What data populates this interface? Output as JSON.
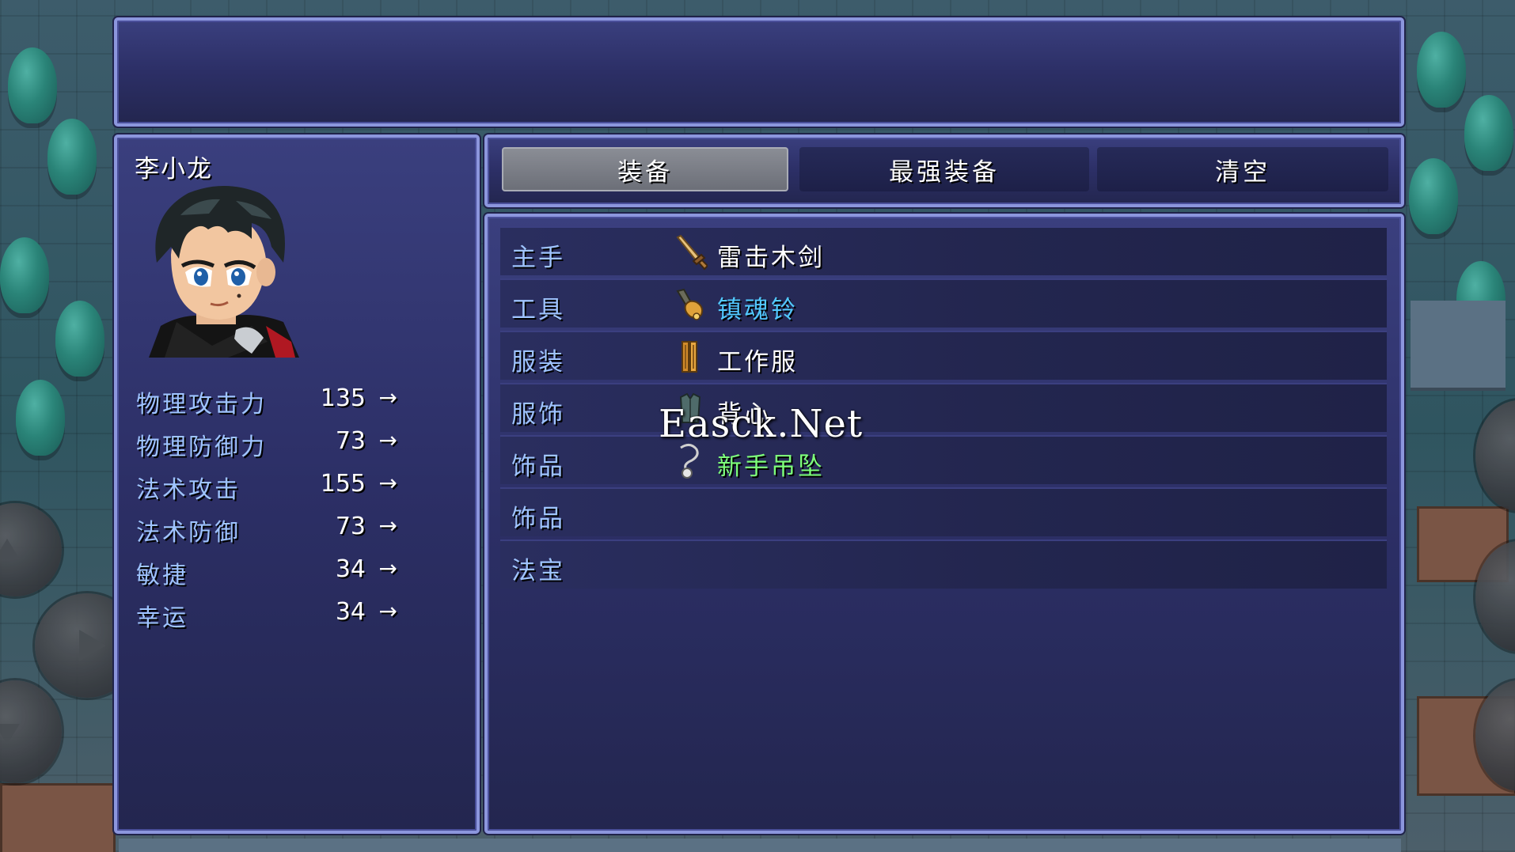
{
  "actor": {
    "name": "李小龙"
  },
  "params": [
    {
      "label": "物理攻击力",
      "value": "135",
      "arrow": "→"
    },
    {
      "label": "物理防御力",
      "value": "73",
      "arrow": "→"
    },
    {
      "label": "法术攻击",
      "value": "155",
      "arrow": "→"
    },
    {
      "label": "法术防御",
      "value": "73",
      "arrow": "→"
    },
    {
      "label": "敏捷",
      "value": "34",
      "arrow": "→"
    },
    {
      "label": "幸运",
      "value": "34",
      "arrow": "→"
    }
  ],
  "commands": [
    {
      "label": "装备",
      "selected": true
    },
    {
      "label": "最强装备",
      "selected": false
    },
    {
      "label": "清空",
      "selected": false
    }
  ],
  "slots": [
    {
      "type": "主手",
      "item": "雷击木剑",
      "icon": "sword-icon",
      "color": "#ffffff"
    },
    {
      "type": "工具",
      "item": "镇魂铃",
      "icon": "bell-icon",
      "color": "#52c8ff"
    },
    {
      "type": "服装",
      "item": "工作服",
      "icon": "clothes-icon",
      "color": "#ffffff"
    },
    {
      "type": "服饰",
      "item": "背心",
      "icon": "vest-icon",
      "color": "#ffffff"
    },
    {
      "type": "饰品",
      "item": "新手吊坠",
      "icon": "pendant-icon",
      "color": "#7dff7a"
    },
    {
      "type": "饰品",
      "item": "",
      "icon": "",
      "color": "#ffffff"
    },
    {
      "type": "法宝",
      "item": "",
      "icon": "",
      "color": "#ffffff"
    }
  ],
  "watermark": "Easck.Net",
  "colors": {
    "window_border": "#8c96dd",
    "system_text": "#9fc4ff",
    "selected_tab": "#7a7d86"
  }
}
